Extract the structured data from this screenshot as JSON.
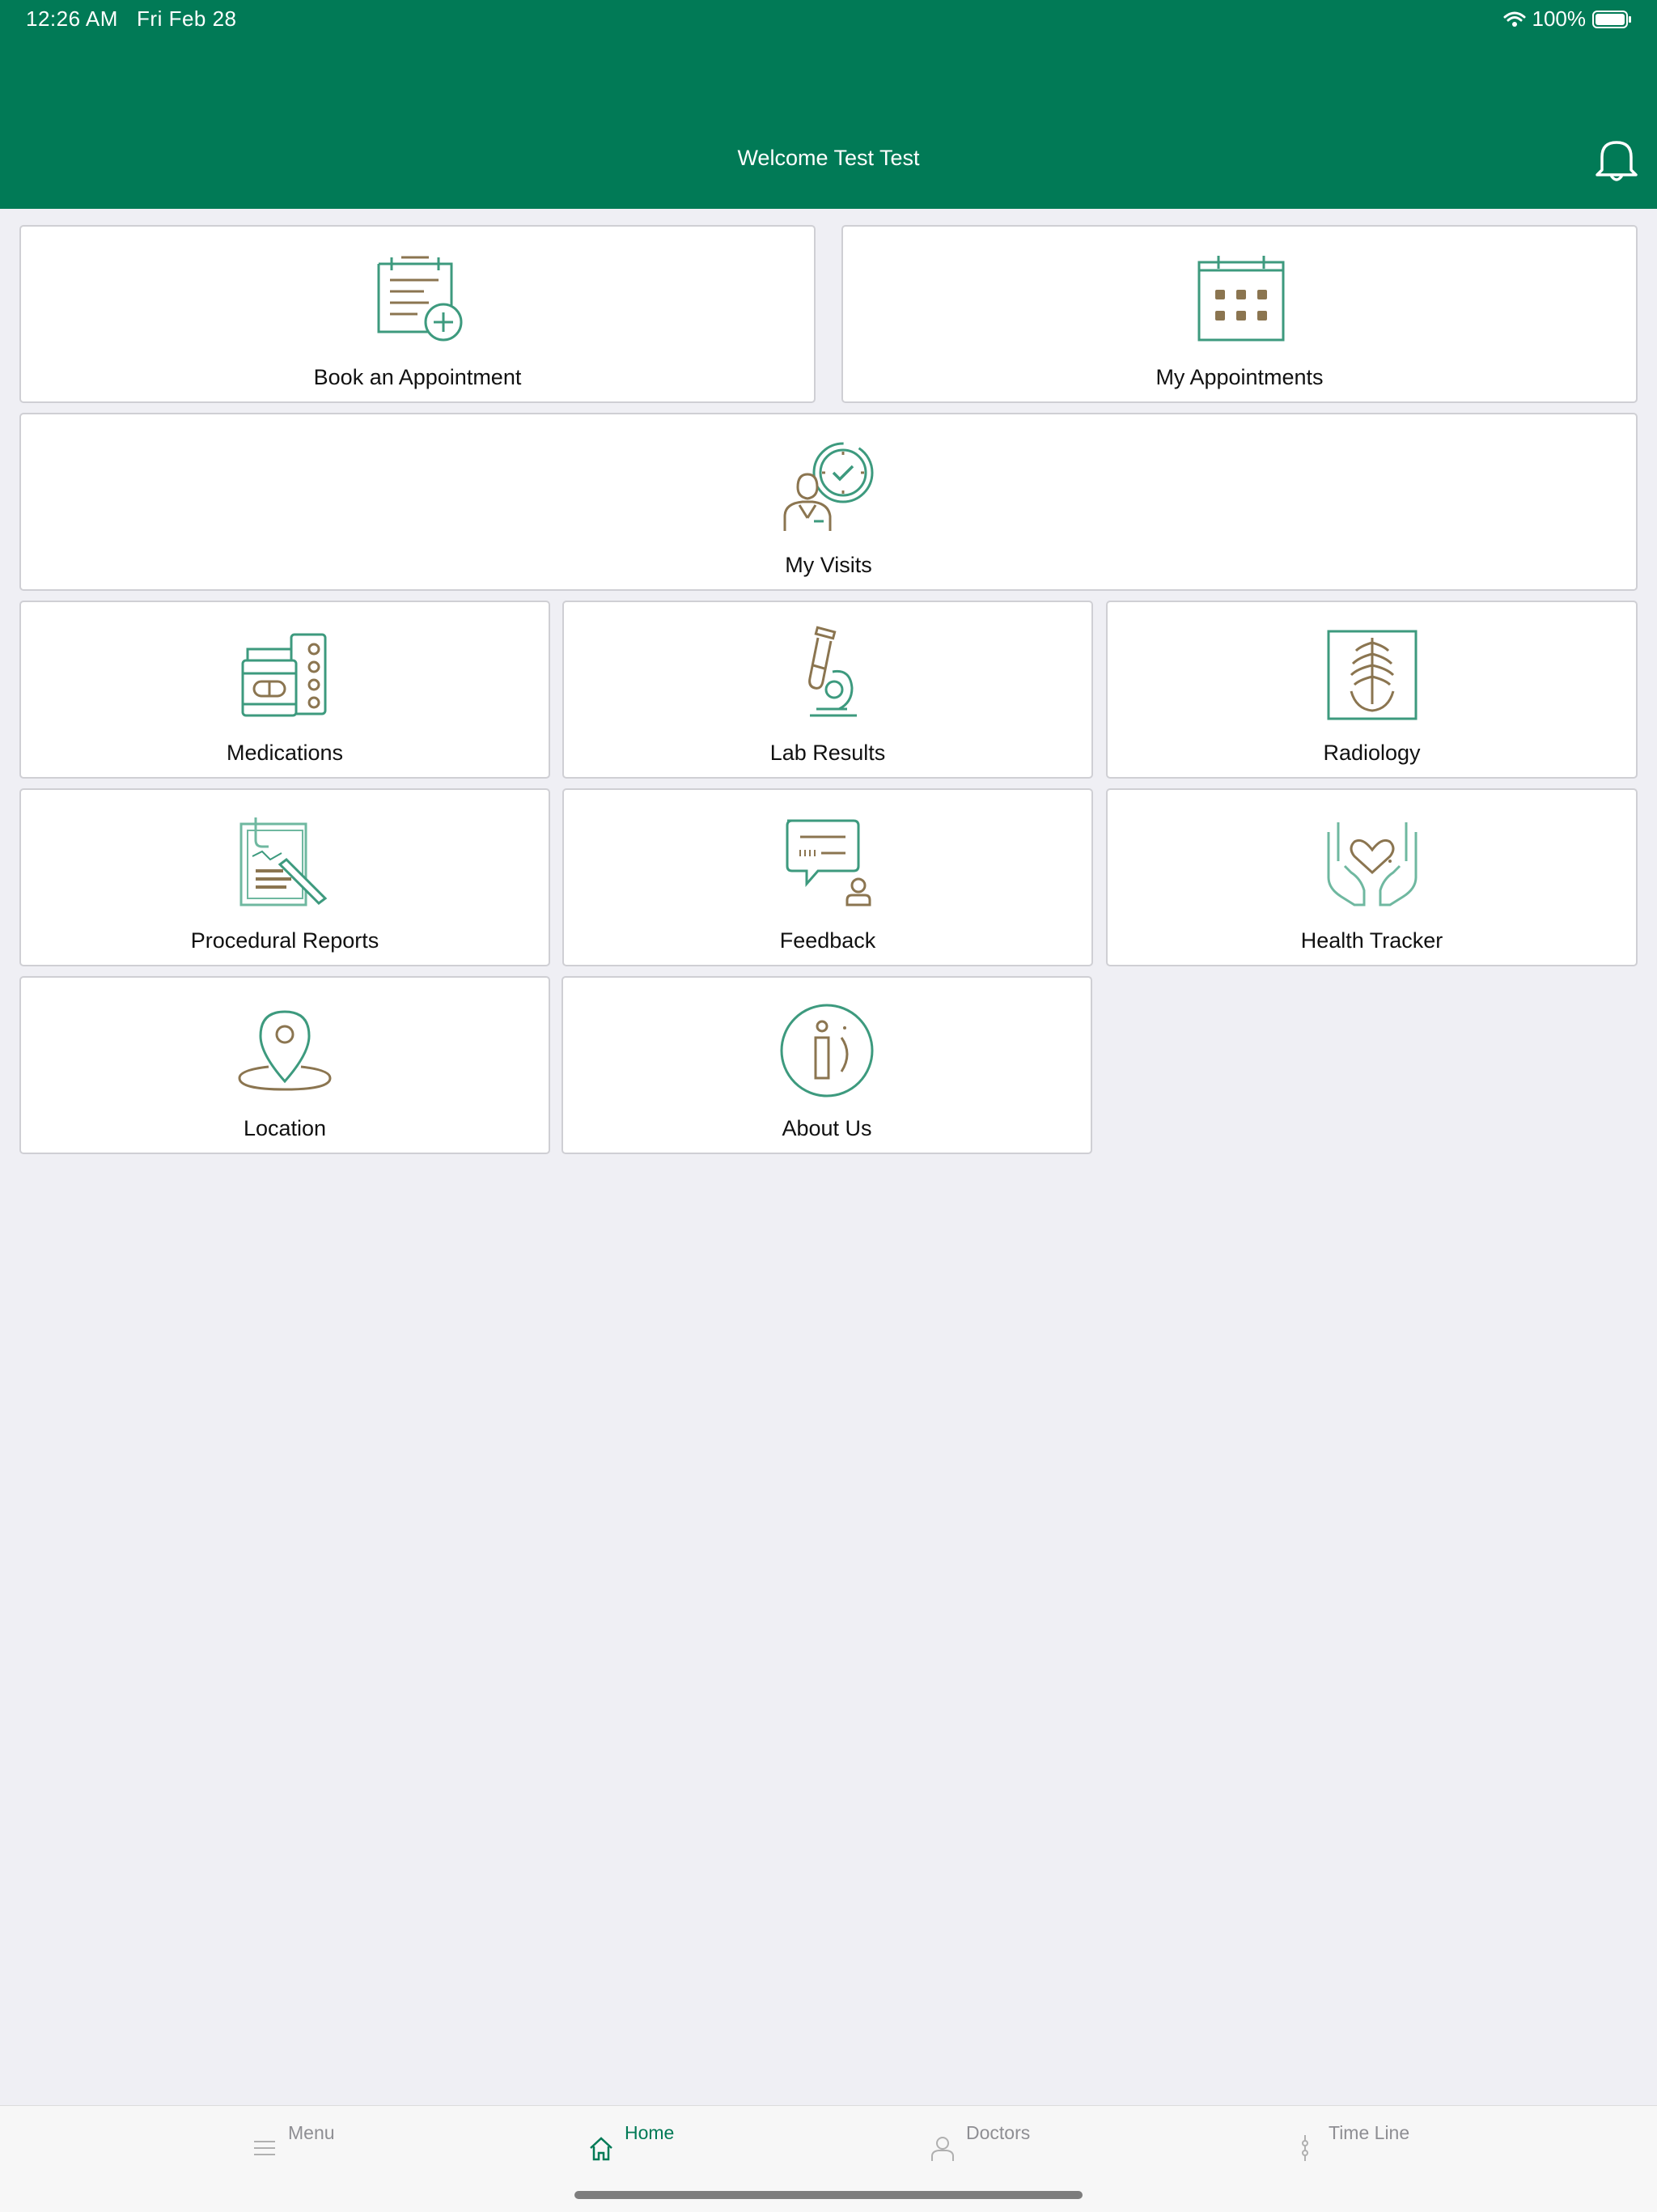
{
  "status_bar": {
    "time": "12:26 AM",
    "date": "Fri Feb 28",
    "battery": "100%"
  },
  "header": {
    "welcome": "Welcome Test Test",
    "bell_icon": "bell-icon"
  },
  "colors": {
    "primary": "#017a56",
    "icon_green": "#3d9a7e",
    "icon_brown": "#8b7550",
    "background": "#efeff4"
  },
  "tiles": {
    "book": {
      "label": "Book an Appointment",
      "icon": "calendar-add-icon"
    },
    "my_appointments": {
      "label": "My Appointments",
      "icon": "calendar-icon"
    },
    "my_visits": {
      "label": "My Visits",
      "icon": "doctor-clock-icon"
    },
    "medications": {
      "label": "Medications",
      "icon": "pill-bottle-icon"
    },
    "lab_results": {
      "label": "Lab Results",
      "icon": "microscope-icon"
    },
    "radiology": {
      "label": "Radiology",
      "icon": "xray-icon"
    },
    "procedural_reports": {
      "label": "Procedural Reports",
      "icon": "clipboard-pen-icon"
    },
    "feedback": {
      "label": "Feedback",
      "icon": "chat-bubble-icon"
    },
    "health_tracker": {
      "label": "Health Tracker",
      "icon": "hands-heart-icon"
    },
    "location": {
      "label": "Location",
      "icon": "map-pin-icon"
    },
    "about_us": {
      "label": "About Us",
      "icon": "info-icon"
    }
  },
  "tabbar": {
    "menu": "Menu",
    "home": "Home",
    "doctors": "Doctors",
    "timeline": "Time Line",
    "active": "home"
  }
}
